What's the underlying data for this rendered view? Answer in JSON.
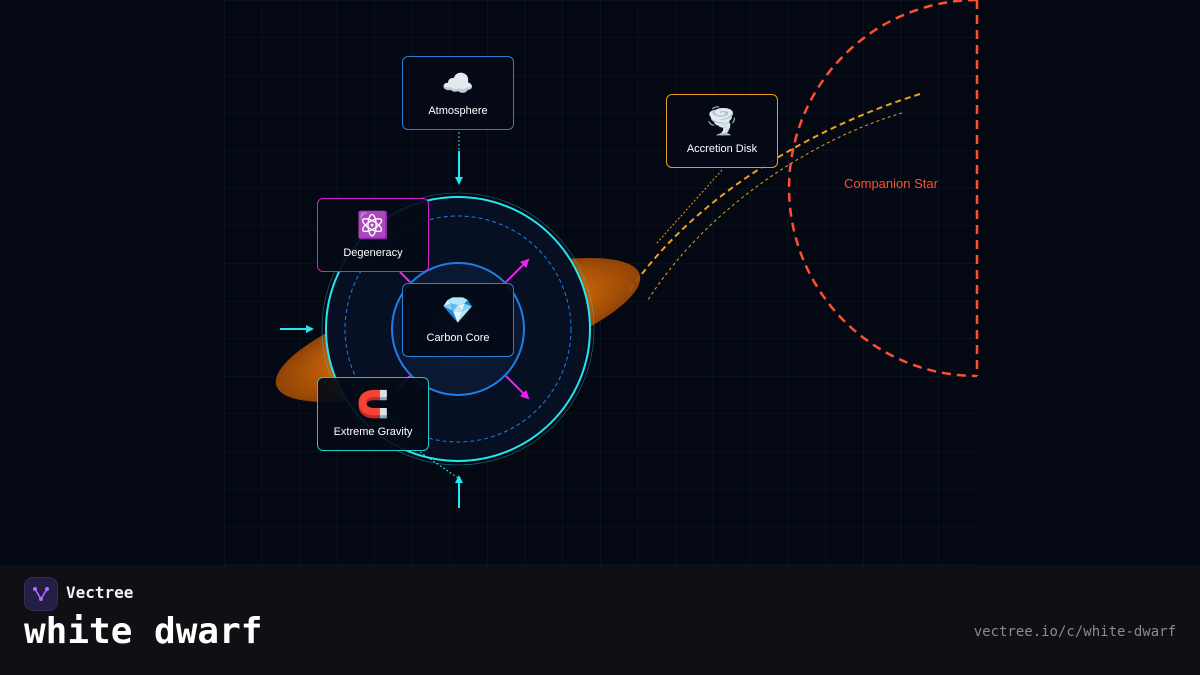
{
  "diagram": {
    "nodes": [
      {
        "id": "atmosphere",
        "label": "Atmosphere",
        "icon": "cloud-icon",
        "glyph": "☁️",
        "color": "#2a7fd4"
      },
      {
        "id": "accretion",
        "label": "Accretion Disk",
        "icon": "tornado-icon",
        "glyph": "🌪️",
        "color": "#e89a1c"
      },
      {
        "id": "degeneracy",
        "label": "Degeneracy",
        "icon": "atom-icon",
        "glyph": "⚛️",
        "color": "#d020d0"
      },
      {
        "id": "core",
        "label": "Carbon Core",
        "icon": "gem-icon",
        "glyph": "💎",
        "color": "#2a7fd4"
      },
      {
        "id": "gravity",
        "label": "Extreme Gravity",
        "icon": "magnet-icon",
        "glyph": "🧲",
        "color": "#1fc8c8"
      }
    ],
    "companion_label": "Companion Star",
    "colors": {
      "cyan": "#22e6f0",
      "blue": "#1e7ee8",
      "magenta": "#ee22ee",
      "orange": "#f0a020",
      "companion": "#ff4f30"
    }
  },
  "footer": {
    "brand": "Vectree",
    "title": "white dwarf",
    "url": "vectree.io/c/white-dwarf"
  }
}
